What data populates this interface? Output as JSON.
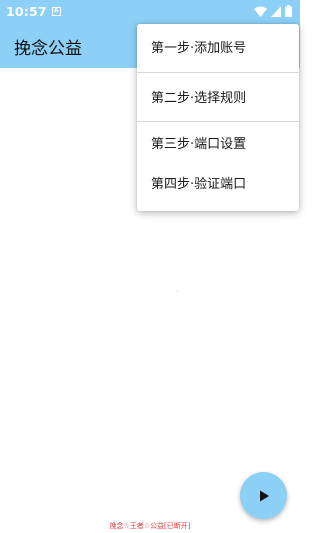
{
  "status_bar": {
    "time": "10:57",
    "notification_icon_letter": "A",
    "icons": [
      "wifi-icon",
      "cell-signal-icon",
      "battery-icon"
    ]
  },
  "app_bar": {
    "title": "挽念公益"
  },
  "menu": {
    "items": [
      {
        "label": "第一步·添加账号"
      },
      {
        "label": "第二步·选择规则"
      },
      {
        "label": "第三步·端口设置"
      },
      {
        "label": "第四步·验证端口"
      }
    ]
  },
  "fab": {
    "icon": "play-icon"
  },
  "footer": {
    "text": "挽念☆王者☆公益[已断开]"
  },
  "colors": {
    "primary": "#8ccff7",
    "footer_text": "#e53935"
  }
}
